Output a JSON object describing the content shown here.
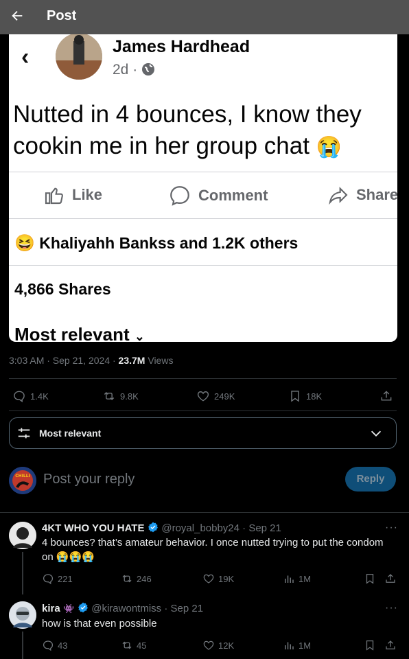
{
  "header": {
    "title": "Post"
  },
  "fb_post": {
    "author": "James Hardhead",
    "meta": "2d ·",
    "body_line1": "Nutted in 4 bounces, I know they",
    "body_line2": "cookin me in her group chat",
    "emoji": "😭",
    "actions": {
      "like": "Like",
      "comment": "Comment",
      "share": "Share"
    },
    "reactors": "Khaliyahh Bankss and 1.2K others",
    "shares": "4,866 Shares",
    "sort": "Most relevant"
  },
  "tweet": {
    "time": "3:03 AM · Sep 21, 2024 · ",
    "views_count": "23.7M",
    "views_label": " Views",
    "stats": {
      "replies": "1.4K",
      "reposts": "9.8K",
      "likes": "249K",
      "bookmarks": "18K"
    }
  },
  "sort": {
    "label": "Most relevant"
  },
  "composer": {
    "placeholder": "Post your reply",
    "button": "Reply"
  },
  "replies": [
    {
      "name": "4KT WHO YOU HATE",
      "handle": "@royal_bobby24 · Sep 21",
      "text": "4 bounces? that’s amateur behavior. I once nutted trying to put the condom",
      "text2": "on 😭😭😭",
      "stats": {
        "replies": "221",
        "reposts": "246",
        "likes": "19K",
        "views": "1M"
      }
    },
    {
      "name": "kira",
      "badge": "👾",
      "handle": "@kirawontmiss · Sep 21",
      "text": "how is that even possible",
      "stats": {
        "replies": "43",
        "reposts": "45",
        "likes": "12K",
        "views": "1M"
      }
    }
  ],
  "colors": {
    "accent": "#1d9bf0",
    "muted": "#71767b",
    "border": "#2f3336"
  }
}
